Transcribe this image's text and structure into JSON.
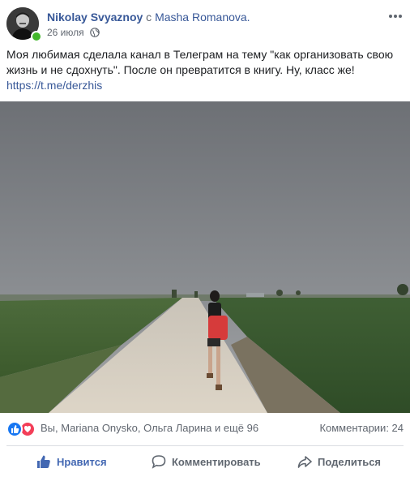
{
  "post": {
    "author": "Nikolay Svyaznoy",
    "with_word": "с",
    "tagged": "Masha Romanova.",
    "date": "26 июля",
    "privacy_icon": "globe-icon",
    "text_line1": "Моя любимая сделала канал в Телеграм на тему \"как организовать свою",
    "text_line2": "жизнь и не сдохнуть\". После он превратится в книгу. Ну, класс же!",
    "link": "https://t.me/derzhis"
  },
  "reactions": {
    "icons": [
      "like-icon",
      "love-icon"
    ],
    "summary": "Вы, Mariana Onysko, Ольга Ларина и ещё 96",
    "comments": "Комментарии: 24"
  },
  "actions": {
    "like_label": "Нравится",
    "comment_label": "Комментировать",
    "share_label": "Поделиться"
  },
  "colors": {
    "link": "#385898",
    "like_active": "#4267b2",
    "online": "#42b72a",
    "love": "#f33e58"
  }
}
